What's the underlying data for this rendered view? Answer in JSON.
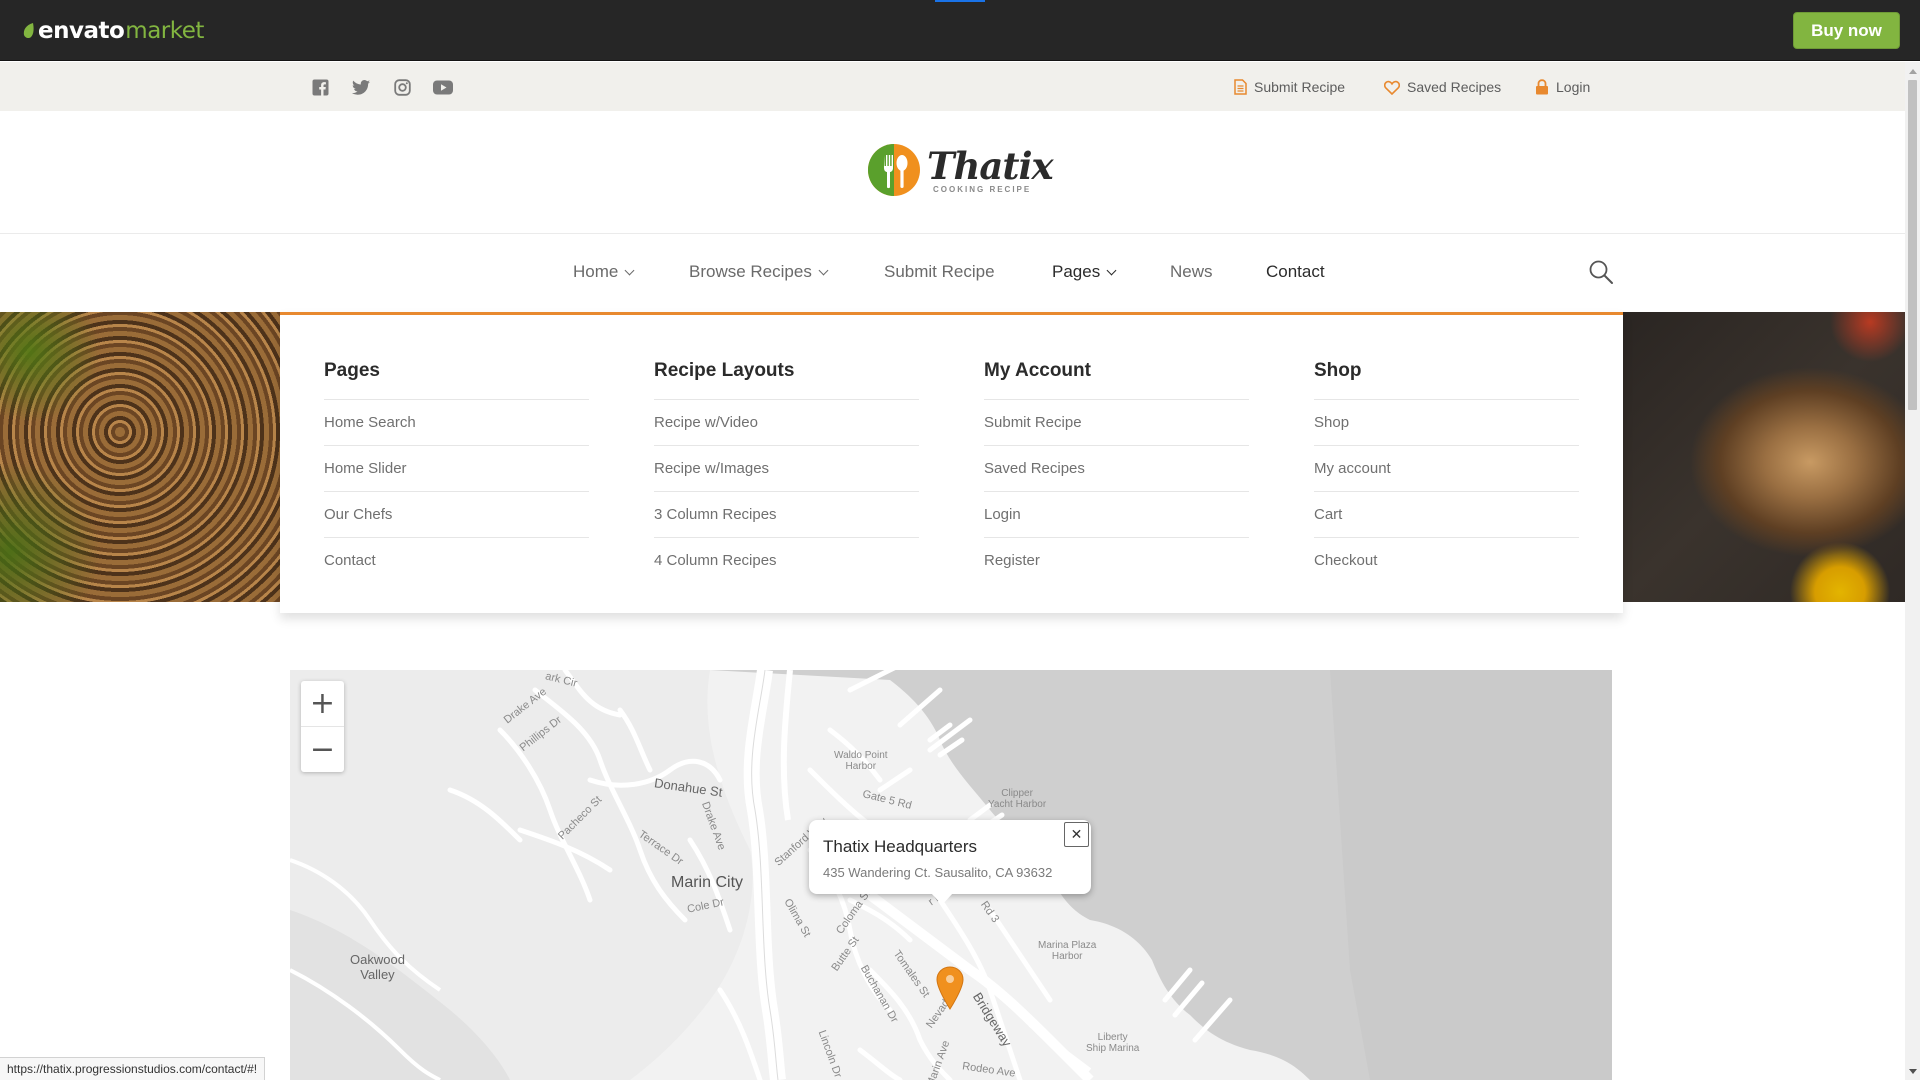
{
  "envato": {
    "logo_brand": "envato",
    "logo_market": "market",
    "buy_label": "Buy now",
    "accent": "#82b540"
  },
  "utility": {
    "social_icons": [
      "facebook-icon",
      "twitter-icon",
      "instagram-icon",
      "youtube-icon"
    ],
    "submit_recipe": "Submit Recipe",
    "saved_recipes": "Saved Recipes",
    "login": "Login",
    "accent": "#e8892f"
  },
  "logo": {
    "name": "Thatix",
    "tagline": "COOKING RECIPE"
  },
  "nav": {
    "items": [
      {
        "label": "Home",
        "dropdown": true
      },
      {
        "label": "Browse Recipes",
        "dropdown": true
      },
      {
        "label": "Submit Recipe",
        "dropdown": false
      },
      {
        "label": "Pages",
        "dropdown": true
      },
      {
        "label": "News",
        "dropdown": false
      },
      {
        "label": "Contact",
        "dropdown": false
      }
    ],
    "search_icon": "search-icon"
  },
  "mega_menu": {
    "columns": [
      {
        "title": "Pages",
        "links": [
          "Home Search",
          "Home Slider",
          "Our Chefs",
          "Contact"
        ]
      },
      {
        "title": "Recipe Layouts",
        "links": [
          "Recipe w/Video",
          "Recipe w/Images",
          "3 Column Recipes",
          "4 Column Recipes"
        ]
      },
      {
        "title": "My Account",
        "links": [
          "Submit Recipe",
          "Saved Recipes",
          "Login",
          "Register"
        ]
      },
      {
        "title": "Shop",
        "links": [
          "Shop",
          "My account",
          "Cart",
          "Checkout"
        ]
      }
    ]
  },
  "map": {
    "zoom_in": "+",
    "zoom_out": "−",
    "labels": {
      "marin_city": "Marin City",
      "oakwood_valley": "Oakwood\nValley",
      "donahue": "Donahue St",
      "drake_ave": "Drake Ave",
      "phillips": "Phillips Dr",
      "pacheco": "Pacheco St",
      "terrace": "Terrace Dr",
      "cole": "Cole Dr",
      "waldo": "Waldo Point\nHarbor",
      "gate5": "Gate 5 Rd",
      "clipper": "Clipper\nYacht Harbor",
      "stanford": "Stanford Way",
      "olima": "Olima St",
      "coloma": "Coloma St",
      "butte": "Butte St",
      "buchanan": "Buchanan Dr",
      "tomales": "Tomales St",
      "nevada": "Nevada St",
      "bridgeway": "Bridgeway",
      "marinaplaza": "Marina Plaza\nHarbor",
      "liberty": "Liberty\nShip Marina",
      "rodeo": "Rodeo Ave",
      "lincoln": "Lincoln Dr",
      "marin_ave": "Marin Ave",
      "park_cir": "ark Cir",
      "rd3": "Rd 3",
      "dr": "r Dr"
    },
    "popup": {
      "title": "Thatix Headquarters",
      "address": "435 Wandering Ct. Sausalito, CA 93632",
      "close": "✕"
    },
    "pin_color": "#f0901e"
  },
  "status_url": "https://thatix.progressionstudios.com/contact/#!"
}
